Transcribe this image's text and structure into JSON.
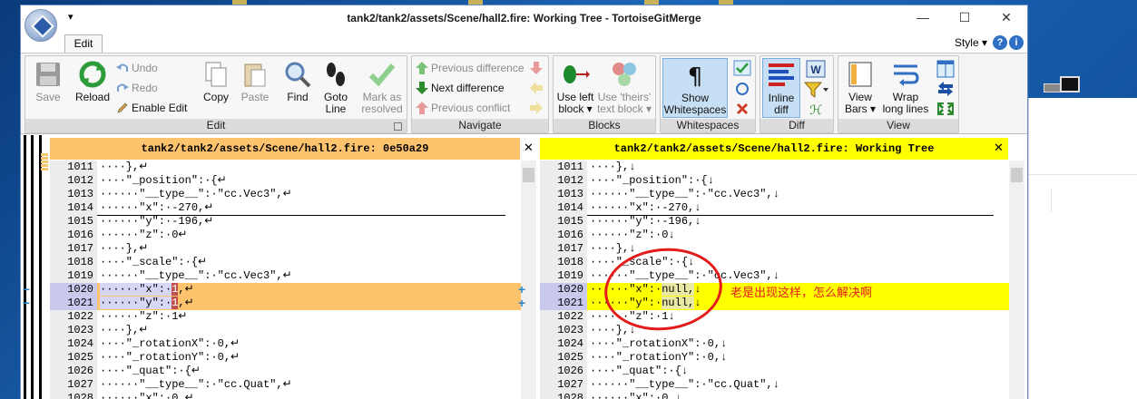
{
  "window": {
    "title": "tank2/tank2/assets/Scene/hall2.fire: Working Tree - TortoiseGitMerge",
    "qat_glyph": "▾",
    "controls": {
      "minimize": "—",
      "maximize": "☐",
      "close": "✕"
    }
  },
  "tabs": {
    "edit": "Edit"
  },
  "style_menu": "Style ▾",
  "help_glyph": "?",
  "info_glyph": "i",
  "ribbon": {
    "edit_group": {
      "title": "Edit",
      "save": "Save",
      "reload": "Reload",
      "undo": "Undo",
      "redo": "Redo",
      "enable_edit": "Enable Edit",
      "copy": "Copy",
      "paste": "Paste",
      "find": "Find",
      "goto_line_1": "Goto",
      "goto_line_2": "Line",
      "mark_resolved_1": "Mark as",
      "mark_resolved_2": "resolved"
    },
    "navigate_group": {
      "title": "Navigate",
      "prev_diff": "Previous difference",
      "next_diff": "Next difference",
      "prev_conflict": "Previous conflict"
    },
    "blocks_group": {
      "title": "Blocks",
      "use_left_1": "Use left",
      "use_left_2": "block ▾",
      "use_theirs_1": "Use 'theirs'",
      "use_theirs_2": "text block ▾"
    },
    "whitespaces_group": {
      "title": "Whitespaces",
      "show_1": "Show",
      "show_2": "Whitespaces"
    },
    "diff_group": {
      "title": "Diff",
      "inline_1": "Inline",
      "inline_2": "diff"
    },
    "view_group": {
      "title": "View",
      "view_bars_1": "View",
      "view_bars_2": "Bars ▾",
      "wrap_1": "Wrap",
      "wrap_2": "long lines"
    }
  },
  "left_pane": {
    "header": "tank2/tank2/assets/Scene/hall2.fire: 0e50a29",
    "lines": [
      {
        "n": "1011",
        "t": "····},↵"
      },
      {
        "n": "1012",
        "t": "····\"_position\":·{↵"
      },
      {
        "n": "1013",
        "t": "······\"__type__\":·\"cc.Vec3\",↵"
      },
      {
        "n": "1014",
        "t": "······\"x\":·-270,↵"
      },
      {
        "n": "1015",
        "t": "······\"y\":·-196,↵"
      },
      {
        "n": "1016",
        "t": "······\"z\":·0↵"
      },
      {
        "n": "1017",
        "t": "····},↵"
      },
      {
        "n": "1018",
        "t": "····\"_scale\":·{↵"
      },
      {
        "n": "1019",
        "t": "······\"__type__\":·\"cc.Vec3\",↵"
      },
      {
        "n": "1020",
        "a": "······\"x\":·",
        "b": "1",
        "c": ",↵"
      },
      {
        "n": "1021",
        "a": "······\"y\":·",
        "b": "1",
        "c": ",↵"
      },
      {
        "n": "1022",
        "t": "······\"z\":·1↵"
      },
      {
        "n": "1023",
        "t": "····},↵"
      },
      {
        "n": "1024",
        "t": "····\"_rotationX\":·0,↵"
      },
      {
        "n": "1025",
        "t": "····\"_rotationY\":·0,↵"
      },
      {
        "n": "1026",
        "t": "····\"_quat\":·{↵"
      },
      {
        "n": "1027",
        "t": "······\"__type__\":·\"cc.Quat\",↵"
      },
      {
        "n": "1028",
        "t": "······\"x\":·0,↵"
      }
    ]
  },
  "right_pane": {
    "header": "tank2/tank2/assets/Scene/hall2.fire: Working Tree",
    "lines": [
      {
        "n": "1011",
        "t": "····},↓"
      },
      {
        "n": "1012",
        "t": "····\"_position\":·{↓"
      },
      {
        "n": "1013",
        "t": "······\"__type__\":·\"cc.Vec3\",↓"
      },
      {
        "n": "1014",
        "t": "······\"x\":·-270,↓"
      },
      {
        "n": "1015",
        "t": "······\"y\":·-196,↓"
      },
      {
        "n": "1016",
        "t": "······\"z\":·0↓"
      },
      {
        "n": "1017",
        "t": "····},↓"
      },
      {
        "n": "1018",
        "t": "····\"_scale\":·{↓"
      },
      {
        "n": "1019",
        "t": "······\"__type__\":·\"cc.Vec3\",↓"
      },
      {
        "n": "1020",
        "a": "······\"x\":·",
        "b": "null,",
        "c": "↓"
      },
      {
        "n": "1021",
        "a": "······\"y\":·",
        "b": "null,",
        "c": "↓"
      },
      {
        "n": "1022",
        "t": "······\"z\":·1↓"
      },
      {
        "n": "1023",
        "t": "····},↓"
      },
      {
        "n": "1024",
        "t": "····\"_rotationX\":·0,↓"
      },
      {
        "n": "1025",
        "t": "····\"_rotationY\":·0,↓"
      },
      {
        "n": "1026",
        "t": "····\"_quat\":·{↓"
      },
      {
        "n": "1027",
        "t": "······\"__type__\":·\"cc.Quat\",↓"
      },
      {
        "n": "1028",
        "t": "······\"x\":·0,↓"
      }
    ]
  },
  "gutter_marks": {
    "removed": "−",
    "added": "+"
  },
  "annotation": {
    "text": "老是出现这样，怎么解决啊"
  },
  "colors": {
    "left_header": "#fdc46d",
    "right_header": "#ffff00",
    "changed_left": "#fdc46d",
    "changed_right": "#ffff00",
    "annotation": "#e41b1b"
  }
}
